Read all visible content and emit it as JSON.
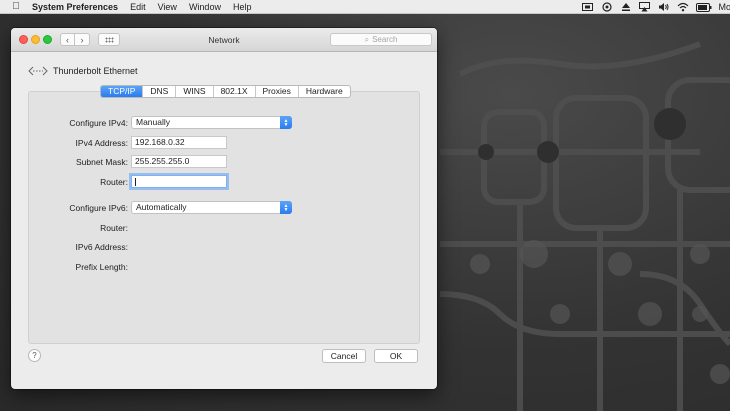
{
  "menubar": {
    "app_name": "System Preferences",
    "items": [
      "Edit",
      "View",
      "Window",
      "Help"
    ],
    "clock_fragment": "Mor",
    "status_icons": [
      "screen-mirror-icon",
      "sync-icon",
      "eject-icon",
      "airplay-icon",
      "volume-icon",
      "wifi-icon",
      "battery-icon"
    ]
  },
  "window": {
    "title": "Network",
    "search_placeholder": "Search",
    "nav_back": "‹",
    "nav_forward": "›"
  },
  "interface": {
    "name": "Thunderbolt Ethernet"
  },
  "tabs": [
    "TCP/IP",
    "DNS",
    "WINS",
    "802.1X",
    "Proxies",
    "Hardware"
  ],
  "active_tab": "TCP/IP",
  "ipv4": {
    "configure_label": "Configure IPv4:",
    "configure_value": "Manually",
    "address_label": "IPv4 Address:",
    "address_value": "192.168.0.32",
    "subnet_label": "Subnet Mask:",
    "subnet_value": "255.255.255.0",
    "router_label": "Router:",
    "router_value": ""
  },
  "ipv6": {
    "configure_label": "Configure IPv6:",
    "configure_value": "Automatically",
    "router_label": "Router:",
    "address_label": "IPv6 Address:",
    "prefix_label": "Prefix Length:"
  },
  "buttons": {
    "help": "?",
    "cancel": "Cancel",
    "ok": "OK"
  },
  "colors": {
    "accent": "#2b7bf0",
    "menubar": "#ececec",
    "window": "#ececec",
    "panel": "#e2e2e2",
    "desktop": "#3a3a3a"
  }
}
